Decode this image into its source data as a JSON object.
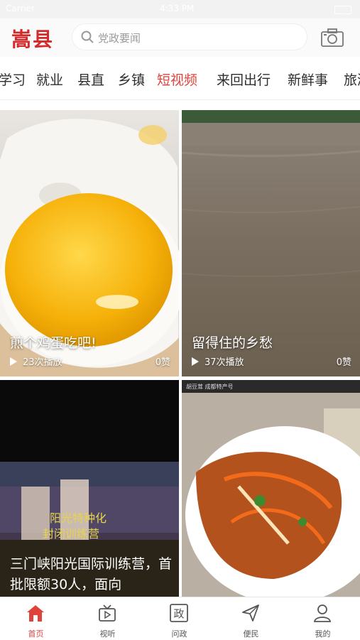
{
  "app": {
    "logo_text": "嵩县"
  },
  "statusbar": {
    "carrier": "Carrier",
    "time": "4:33 PM"
  },
  "search": {
    "placeholder": "党政要闻",
    "icon": "search-icon"
  },
  "header": {
    "camera_icon": "camera-icon"
  },
  "channels": [
    "学习",
    "就业",
    "县直",
    "乡镇",
    "短视频",
    "来回出行",
    "新鲜事",
    "旅游"
  ],
  "active_channel": "短视频",
  "videos": [
    {
      "title": "煎个鸡蛋吃吧!",
      "plays": "23次播放",
      "likes": "0赞"
    },
    {
      "title": "留得住的乡愁",
      "plays": "37次播放",
      "likes": "0赞"
    },
    {
      "title": "三门峡阳光国际训练营，首批限额30人，面向",
      "image_overlay_text": [
        "阳光特种化",
        "封闭训练营"
      ]
    },
    {
      "title": "",
      "image_overlay_text": "胡豆茸 成都特产号"
    }
  ],
  "tabbar": [
    {
      "label": "首页",
      "icon": "home-icon"
    },
    {
      "label": "视听",
      "icon": "tv-icon"
    },
    {
      "label": "问政",
      "icon": "zheng-icon"
    },
    {
      "label": "便民",
      "icon": "send-icon"
    },
    {
      "label": "我的",
      "icon": "user-icon"
    }
  ],
  "colors": {
    "accent": "#e0433c",
    "logo": "#d42a2a"
  }
}
